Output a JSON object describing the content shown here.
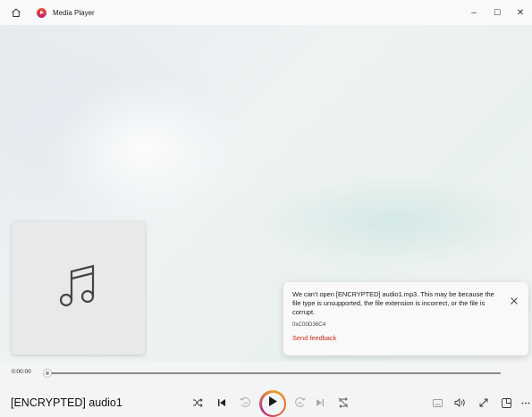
{
  "app": {
    "title": "Media Player"
  },
  "window_controls": {
    "minimize": "–",
    "maximize": "☐",
    "close": "✕"
  },
  "toast": {
    "message": "We can't open [ENCRYPTED] audio1.mp3. This may be because the file type is unsupported, the file extension is incorrect, or the file is corrupt.",
    "code": "0xC00D36C4",
    "link": "Send feedback"
  },
  "playback": {
    "current_time": "0:00:00",
    "progress": 0.0,
    "track_title": "[ENCRYPTED] audio1"
  },
  "controls": {
    "skip_back_label": "10",
    "skip_forward_label": "30"
  },
  "colors": {
    "accent_link": "#c42b1c",
    "play_gradient": [
      "#f0a02c",
      "#e6602a",
      "#b3358c"
    ]
  }
}
